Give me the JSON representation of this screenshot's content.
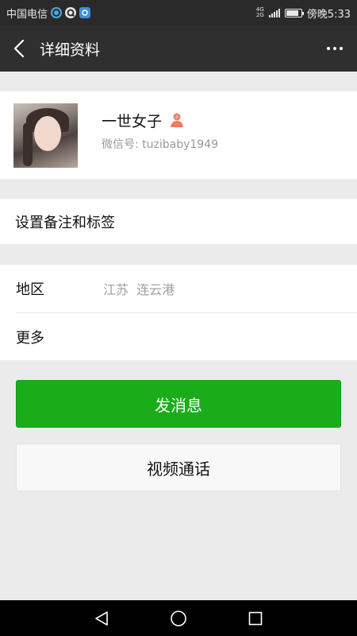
{
  "status_bar": {
    "carrier": "中国电信",
    "network_top": "4G",
    "network_bottom": "2G",
    "time_text": "傍晚5:33",
    "battery_level_percent": 85
  },
  "header": {
    "title": "详细资料"
  },
  "profile": {
    "nickname": "一世女子",
    "wechat_id": "微信号: tuzibaby1949"
  },
  "remark": {
    "label": "设置备注和标签"
  },
  "info": {
    "region_label": "地区",
    "region_value": "江苏  连云港",
    "more_label": "更多"
  },
  "actions": {
    "send_message": "发消息",
    "video_call": "视频通话"
  },
  "colors": {
    "primary_green": "#1aad19",
    "title_bar": "#2f2f2f",
    "status_bar": "#2a2a2a",
    "gender_icon": "#f37b5c"
  }
}
